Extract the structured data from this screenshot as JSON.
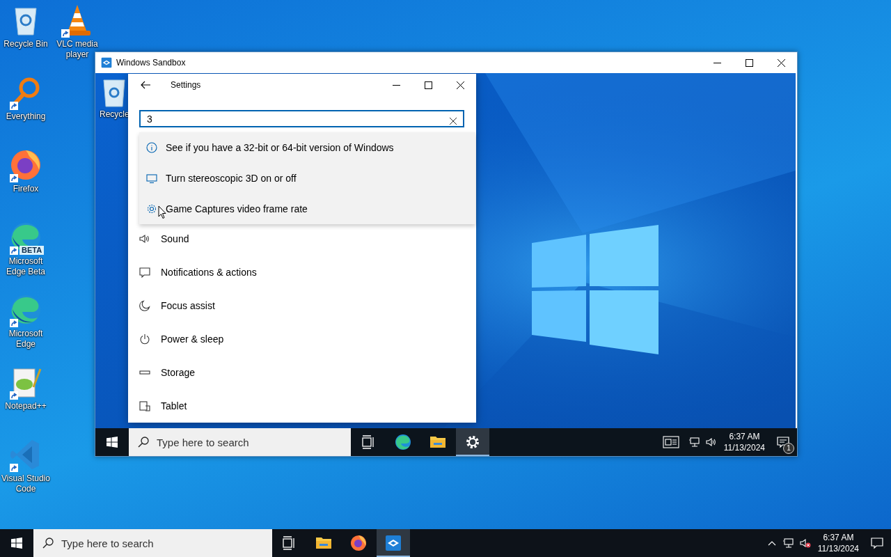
{
  "desktop_icons": [
    {
      "label": "Recycle Bin",
      "kind": "recycle",
      "shortcut": false
    },
    {
      "label": "VLC media player",
      "kind": "vlc",
      "shortcut": true
    },
    {
      "label": "Everything",
      "kind": "everything",
      "shortcut": true
    },
    {
      "label": "Firefox",
      "kind": "firefox",
      "shortcut": true
    },
    {
      "label": "Microsoft Edge Beta",
      "kind": "edge",
      "shortcut": true,
      "badge": "BETA"
    },
    {
      "label": "Microsoft Edge",
      "kind": "edge",
      "shortcut": true
    },
    {
      "label": "Notepad++",
      "kind": "notepad",
      "shortcut": true
    },
    {
      "label": "Visual Studio Code",
      "kind": "vscode",
      "shortcut": true
    }
  ],
  "sandbox_window": {
    "title": "Windows Sandbox",
    "desktop_icons": [
      {
        "label": "Recycle",
        "kind": "recycle"
      }
    ],
    "settings_window": {
      "title": "Settings",
      "search": {
        "value": "3"
      },
      "suggestions": [
        {
          "text": "See if you have a 32-bit or 64-bit version of Windows",
          "kind": "info"
        },
        {
          "text": "Turn stereoscopic 3D on or off",
          "kind": "monitor"
        },
        {
          "text": "Game Captures video frame rate",
          "kind": "gear"
        }
      ],
      "nav_items": [
        {
          "label": "Sound",
          "kind": "sound"
        },
        {
          "label": "Notifications & actions",
          "kind": "notification"
        },
        {
          "label": "Focus assist",
          "kind": "moon"
        },
        {
          "label": "Power & sleep",
          "kind": "power"
        },
        {
          "label": "Storage",
          "kind": "storage"
        },
        {
          "label": "Tablet",
          "kind": "tablet"
        }
      ]
    },
    "taskbar": {
      "search": {
        "placeholder": "Type here to search"
      },
      "apps": [
        {
          "kind": "taskview",
          "selected": false
        },
        {
          "kind": "edge",
          "selected": false
        },
        {
          "kind": "explorer",
          "selected": false
        },
        {
          "kind": "settings",
          "selected": true
        }
      ],
      "tray": [
        {
          "kind": "news"
        },
        {
          "kind": "network"
        },
        {
          "kind": "volume",
          "muted": false
        }
      ],
      "time": "6:37 AM",
      "date": "11/13/2024",
      "notification_count": "1"
    }
  },
  "taskbar": {
    "search": {
      "placeholder": "Type here to search"
    },
    "apps": [
      {
        "kind": "taskview",
        "selected": false
      },
      {
        "kind": "explorer",
        "selected": false
      },
      {
        "kind": "firefox",
        "selected": false
      },
      {
        "kind": "sandbox",
        "selected": true
      }
    ],
    "tray": [
      {
        "kind": "chevron"
      },
      {
        "kind": "network"
      },
      {
        "kind": "volume",
        "muted": true
      }
    ],
    "time": "6:37 AM",
    "date": "11/13/2024"
  }
}
